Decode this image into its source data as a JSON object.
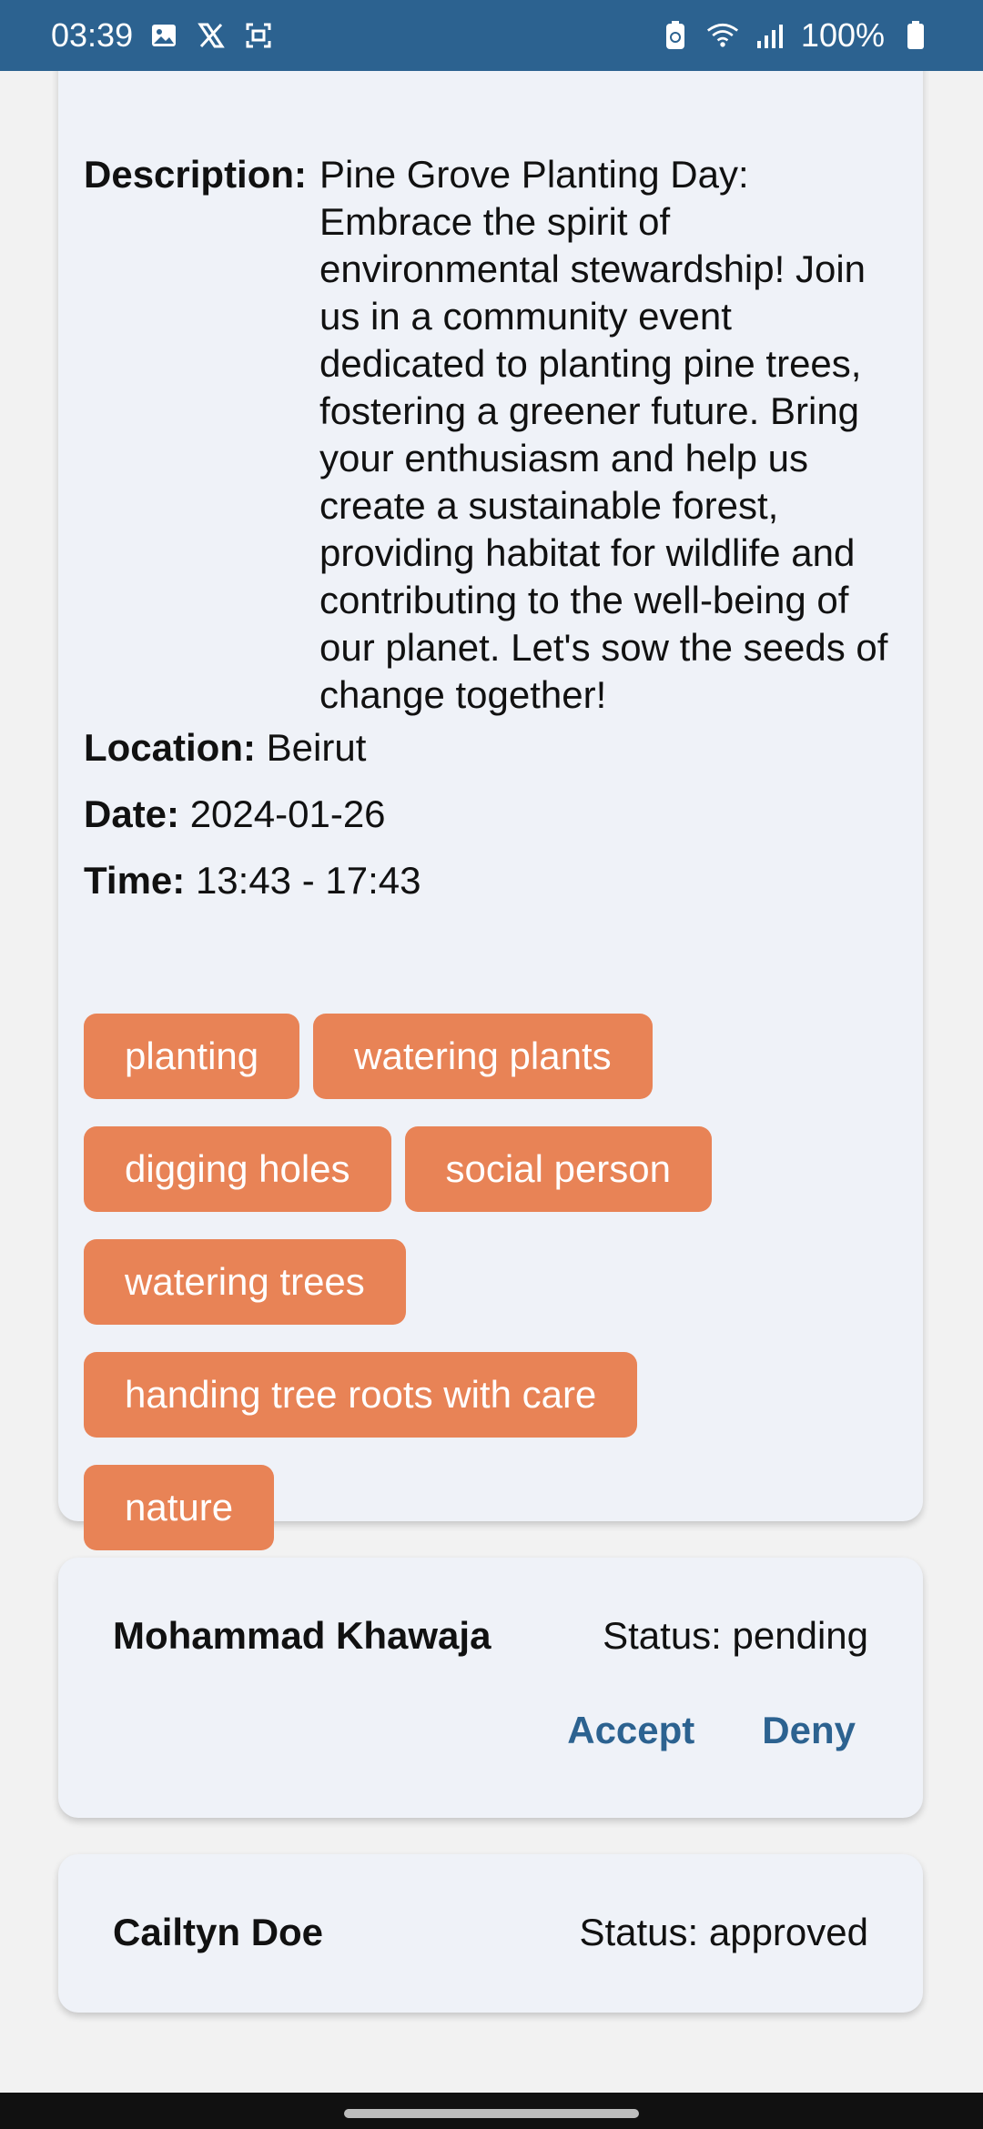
{
  "status_bar": {
    "time": "03:39",
    "battery": "100%",
    "icons_left": [
      "image-icon",
      "x-logo-icon",
      "screenshot-icon"
    ],
    "icons_right": [
      "battery-saver-icon",
      "wifi-icon",
      "signal-icon",
      "battery-icon"
    ]
  },
  "event": {
    "description_label": "Description:",
    "description": "Pine Grove Planting Day: Embrace the spirit of environmental stewardship! Join us in a community event dedicated to planting pine trees, fostering a greener future. Bring your enthusiasm and help us create a sustainable forest, providing habitat for wildlife and contributing to the well-being of our planet. Let's sow the seeds of change together!",
    "location_label": "Location:",
    "location": "Beirut",
    "date_label": "Date:",
    "date": "2024-01-26",
    "time_label": "Time:",
    "time": "13:43 - 17:43",
    "tags": [
      "planting",
      "watering plants",
      "digging holes",
      "social person",
      "watering trees",
      "handing tree roots with care",
      "nature"
    ]
  },
  "applicants": [
    {
      "name": "Mohammad Khawaja",
      "status": "Status: pending",
      "accept_label": "Accept",
      "deny_label": "Deny"
    },
    {
      "name": "Cailtyn Doe",
      "status": "Status: approved"
    }
  ],
  "colors": {
    "app_bar": "#2c6290",
    "tag": "#e88356",
    "card": "#eff2f8",
    "action": "#2c6290"
  }
}
